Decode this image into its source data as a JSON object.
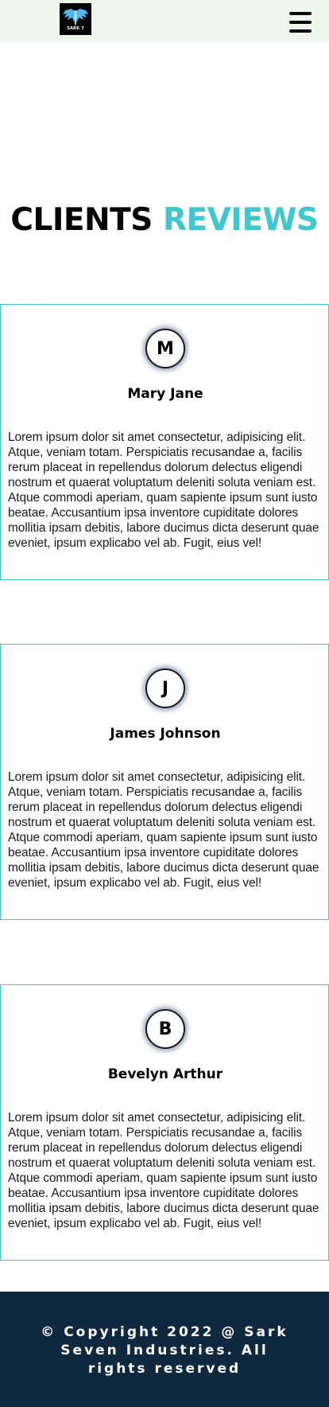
{
  "header": {
    "logo_text": "SARK 7",
    "logo_icon": "winged-logo-icon",
    "menu_icon": "hamburger-menu-icon"
  },
  "section": {
    "title_part1": "CLIENTS",
    "title_part2": "REVIEWS"
  },
  "reviews": [
    {
      "initial": "M",
      "name": "Mary Jane",
      "text": "Lorem ipsum dolor sit amet consectetur, adipisicing elit. Atque, veniam totam. Perspiciatis recusandae a, facilis rerum placeat in repellendus dolorum delectus eligendi nostrum et quaerat voluptatum deleniti soluta veniam est. Atque commodi aperiam, quam sapiente ipsum sunt iusto beatae. Accusantium ipsa inventore cupiditate dolores mollitia ipsam debitis, labore ducimus dicta deserunt quae eveniet, ipsum explicabo vel ab. Fugit, eius vel!"
    },
    {
      "initial": "J",
      "name": "James Johnson",
      "text": "Lorem ipsum dolor sit amet consectetur, adipisicing elit. Atque, veniam totam. Perspiciatis recusandae a, facilis rerum placeat in repellendus dolorum delectus eligendi nostrum et quaerat voluptatum deleniti soluta veniam est. Atque commodi aperiam, quam sapiente ipsum sunt iusto beatae. Accusantium ipsa inventore cupiditate dolores mollitia ipsam debitis, labore ducimus dicta deserunt quae eveniet, ipsum explicabo vel ab. Fugit, eius vel!"
    },
    {
      "initial": "B",
      "name": "Bevelyn Arthur",
      "text": "Lorem ipsum dolor sit amet consectetur, adipisicing elit. Atque, veniam totam. Perspiciatis recusandae a, facilis rerum placeat in repellendus dolorum delectus eligendi nostrum et quaerat voluptatum deleniti soluta veniam est. Atque commodi aperiam, quam sapiente ipsum sunt iusto beatae. Accusantium ipsa inventore cupiditate dolores mollitia ipsam debitis, labore ducimus dicta deserunt quae eveniet, ipsum explicabo vel ab. Fugit, eius vel!"
    }
  ],
  "footer": {
    "copyright": "© Copyright 2022 @ Sark Seven Industries. All rights reserved"
  },
  "colors": {
    "header_bg": "#eef6ec",
    "accent": "#3fc6cf",
    "card_border": "#40c4cc",
    "footer_bg": "#0f2940"
  }
}
